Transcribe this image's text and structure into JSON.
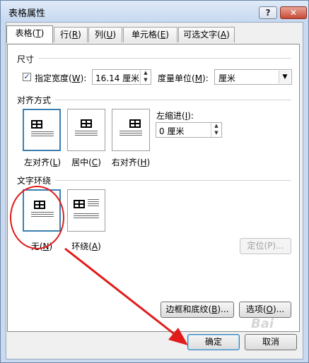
{
  "window": {
    "title": "表格属性",
    "help_glyph": "?",
    "close_glyph": "✕"
  },
  "tabs": [
    {
      "label": "表格(",
      "key": "T",
      "suffix": ")"
    },
    {
      "label": "行(",
      "key": "R",
      "suffix": ")"
    },
    {
      "label": "列(",
      "key": "U",
      "suffix": ")"
    },
    {
      "label": "单元格(",
      "key": "E",
      "suffix": ")"
    },
    {
      "label": "可选文字(",
      "key": "A",
      "suffix": ")"
    }
  ],
  "size": {
    "group_label": "尺寸",
    "preferred_width_label_pre": "指定宽度(",
    "preferred_width_key": "W",
    "preferred_width_label_post": "):",
    "preferred_width_checked": "✓",
    "preferred_width_value": "16.14 厘米",
    "measure_label_pre": "度量单位(",
    "measure_key": "M",
    "measure_label_post": "):",
    "measure_value": "厘米"
  },
  "alignment": {
    "group_label": "对齐方式",
    "options": [
      {
        "pre": "左对齐(",
        "key": "L",
        "post": ")"
      },
      {
        "pre": "居中(",
        "key": "C",
        "post": ")"
      },
      {
        "pre": "右对齐(",
        "key": "H",
        "post": ")"
      }
    ],
    "indent_label_pre": "左缩进(",
    "indent_key": "I",
    "indent_label_post": "):",
    "indent_value": "0 厘米"
  },
  "wrapping": {
    "group_label": "文字环绕",
    "options": [
      {
        "pre": "无(",
        "key": "N",
        "post": ")"
      },
      {
        "pre": "环绕(",
        "key": "A",
        "post": ")"
      }
    ],
    "positioning_label": "定位(P)..."
  },
  "buttons": {
    "borders_pre": "边框和底纹(",
    "borders_key": "B",
    "borders_post": ")...",
    "options_pre": "选项(",
    "options_key": "O",
    "options_post": ")...",
    "ok": "确定",
    "cancel": "取消"
  },
  "spin_up": "▲",
  "spin_down": "▼",
  "dropdown_arrow": "▼",
  "watermark": "Bai"
}
